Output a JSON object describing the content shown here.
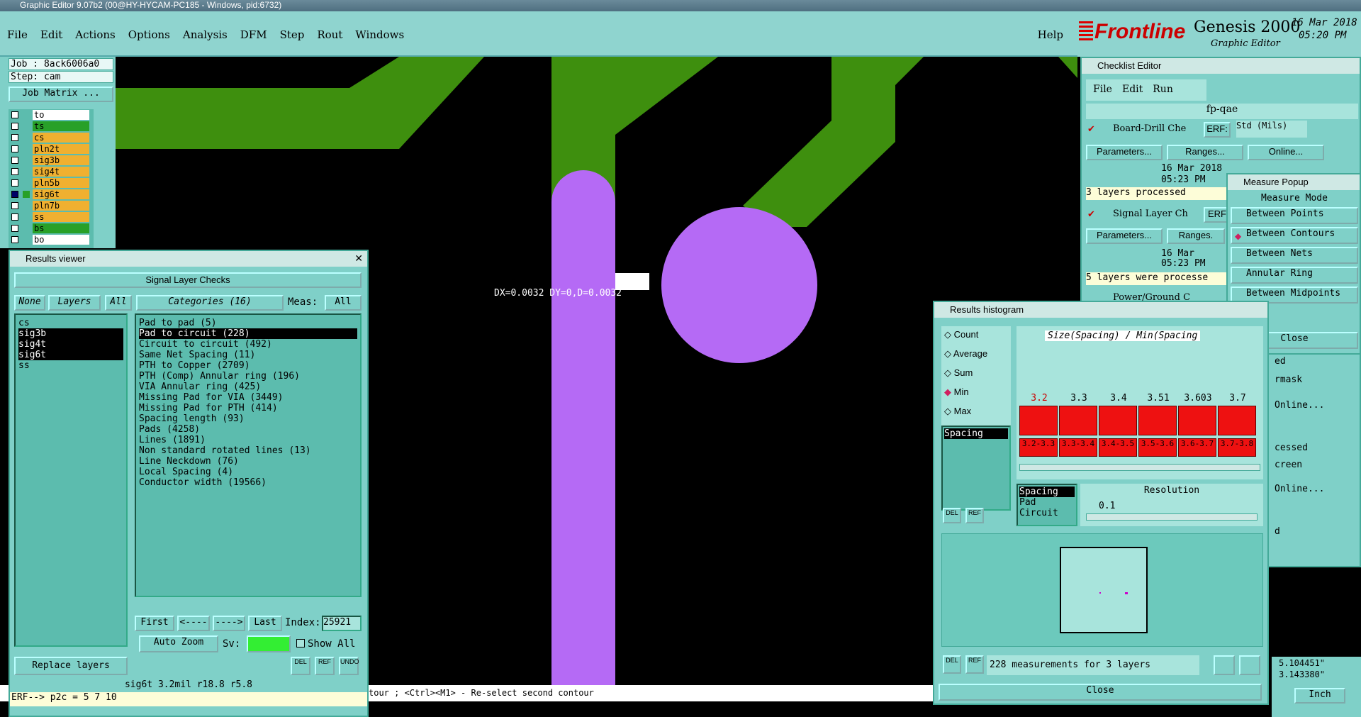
{
  "window_title": "Graphic Editor 9.07b2 (00@HY-HYCAM-PC185 - Windows, pid:6732)",
  "menu": [
    "File",
    "Edit",
    "Actions",
    "Options",
    "Analysis",
    "DFM",
    "Step",
    "Rout",
    "Windows"
  ],
  "help": "Help",
  "brand": {
    "logo": "Frontline",
    "product": "Genesis 2000",
    "subtitle": "Graphic Editor",
    "date": "16 Mar 2018",
    "time": "05:20 PM"
  },
  "job": {
    "job": "Job : 8ack6006a0",
    "step": "Step: cam",
    "matrix_button": "Job Matrix ..."
  },
  "layers": [
    "to",
    "ts",
    "cs",
    "pln2t",
    "sig3b",
    "sig4t",
    "pln5b",
    "sig6t",
    "pln7b",
    "ss",
    "bs",
    "bo"
  ],
  "canvas": {
    "measure_text": "DX=0.0032 DY=0,D=0.0032"
  },
  "results_viewer": {
    "title": "Results viewer",
    "header": "Signal Layer Checks",
    "none": "None",
    "layers": "Layers",
    "all": "All",
    "categories_btn": "Categories (16)",
    "meas_label": "Meas:",
    "meas_value": "All",
    "layer_list": [
      "cs",
      "sig3b",
      "sig4t",
      "sig6t",
      "ss"
    ],
    "categories": [
      "Pad to pad (5)",
      "Pad to circuit (228)",
      "Circuit to circuit (492)",
      "Same Net Spacing (11)",
      "PTH to Copper (2709)",
      "PTH (Comp) Annular ring (196)",
      "VIA Annular ring (425)",
      "Missing Pad for VIA (3449)",
      "Missing Pad for PTH (414)",
      "Spacing length (93)",
      "Pads (4258)",
      "Lines (1891)",
      "Non standard rotated lines (13)",
      "Line Neckdown (76)",
      "Local Spacing (4)",
      "Conductor width (19566)"
    ],
    "nav": [
      "First",
      "<----",
      "---->",
      "Last"
    ],
    "index_label": "Index:",
    "index_value": "25921",
    "auto_zoom": "Auto Zoom",
    "sv_label": "Sv:",
    "show_all": "Show All",
    "replace_layers": "Replace layers",
    "status": "sig6t 3.2mil  r18.8  r5.8",
    "erf": "ERF--> p2c = 5 7 10",
    "icons": [
      "DEL",
      "REF",
      "UNDO"
    ]
  },
  "prompt_line": "tour ; <Ctrl><M1> - Re-select second contour",
  "checklist": {
    "title": "Checklist Editor",
    "menu": [
      "File",
      "Edit",
      "Run"
    ],
    "name": "fp-qae",
    "item1": {
      "name": "Board-Drill Che",
      "erf": "ERF:",
      "std": "Std (Mils)",
      "params": "Parameters...",
      "ranges": "Ranges...",
      "online": "Online...",
      "date": "16 Mar 2018",
      "time": "05:23 PM",
      "status": "3 layers processed"
    },
    "item2": {
      "name": "Signal Layer Ch",
      "erf": "ERF",
      "params": "Parameters...",
      "ranges": "Ranges.",
      "date": "16 Mar",
      "time": "05:23 PM",
      "status": "5 layers were processe"
    },
    "item3": {
      "name": "Power/Ground C",
      "erf": "ERF"
    },
    "right_partial": [
      "ed",
      "rmask",
      "Online...",
      "cessed",
      "creen",
      "Online...",
      "d"
    ]
  },
  "measure_popup": {
    "title": "Measure Popup",
    "header": "Measure Mode",
    "modes": [
      "Between Points",
      "Between Contours",
      "Between Nets",
      "Annular Ring",
      "Between Midpoints"
    ],
    "selected": "Between Contours",
    "close": "Close"
  },
  "histogram": {
    "title": "Results histogram",
    "options": [
      "Count",
      "Average",
      "Sum",
      "Min",
      "Max"
    ],
    "selected": "Min",
    "chart_title": "Size(Spacing) / Min(Spacing",
    "list_left": [
      "Spacing"
    ],
    "list_sel": [
      "Spacing",
      "Pad",
      "Circuit"
    ],
    "resolution_label": "Resolution",
    "resolution_value": "0.1",
    "status": "228 measurements for 3 layers",
    "close": "Close",
    "icons": [
      "DEL",
      "REF"
    ]
  },
  "chart_data": {
    "type": "bar",
    "title": "Size(Spacing) / Min(Spacing",
    "categories": [
      "3.2-3.3",
      "3.3-3.4",
      "3.4-3.5",
      "3.5-3.6",
      "3.6-3.7",
      "3.7-3.8"
    ],
    "bar_labels": [
      "3.2",
      "3.3",
      "3.4",
      "3.51",
      "3.603",
      "3.7"
    ],
    "values": [
      1,
      1,
      1,
      1,
      1,
      1
    ]
  },
  "coords": {
    "x": "5.104451\"",
    "y": "3.143380\"",
    "units": "Inch"
  }
}
